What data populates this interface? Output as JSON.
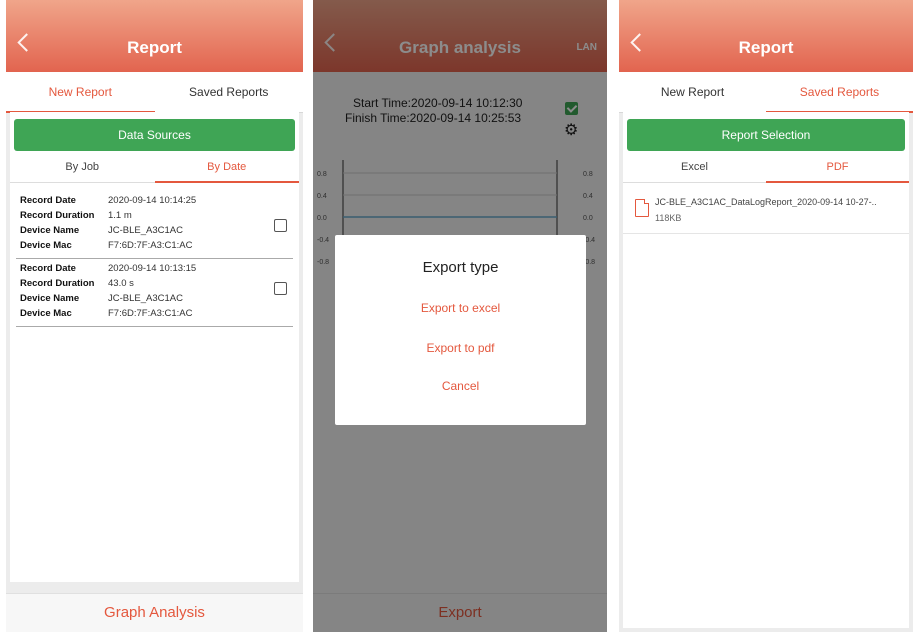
{
  "screen1": {
    "title": "Report",
    "tabs": [
      "New Report",
      "Saved Reports"
    ],
    "data_sources_label": "Data Sources",
    "subtabs": [
      "By Job",
      "By Date"
    ],
    "labels": {
      "record_date": "Record Date",
      "record_duration": "Record Duration",
      "device_name": "Device Name",
      "device_mac": "Device Mac"
    },
    "records": [
      {
        "date": "2020-09-14 10:14:25",
        "duration": "1.1 m",
        "device": "JC-BLE_A3C1AC",
        "mac": "F7:6D:7F:A3:C1:AC"
      },
      {
        "date": "2020-09-14 10:13:15",
        "duration": "43.0 s",
        "device": "JC-BLE_A3C1AC",
        "mac": "F7:6D:7F:A3:C1:AC"
      }
    ],
    "bottom_button": "Graph Analysis"
  },
  "screen2": {
    "title": "Graph analysis",
    "lan": "LAN",
    "start_time": "Start Time:2020-09-14 10:12:30",
    "finish_time": "Finish Time:2020-09-14 10:25:53",
    "axis_left": [
      "0.8",
      "0.4",
      "0.0",
      "-0.4",
      "-0.8"
    ],
    "axis_right": [
      "0.8",
      "0.4",
      "0.0",
      "-0.4",
      "-0.8"
    ],
    "dialog": {
      "title": "Export type",
      "items": [
        "Export to excel",
        "Export to pdf",
        "Cancel"
      ]
    },
    "bottom_button": "Export"
  },
  "screen3": {
    "title": "Report",
    "tabs": [
      "New Report",
      "Saved Reports"
    ],
    "report_selection_label": "Report Selection",
    "subtabs": [
      "Excel",
      "PDF"
    ],
    "file": {
      "name": "JC-BLE_A3C1AC_DataLogReport_2020-09-14 10-27-..",
      "size": "118KB"
    }
  },
  "colors": {
    "accent": "#e4583e",
    "green": "#3fa555",
    "header_top": "#f0a58a",
    "header_bottom": "#e2644f"
  }
}
